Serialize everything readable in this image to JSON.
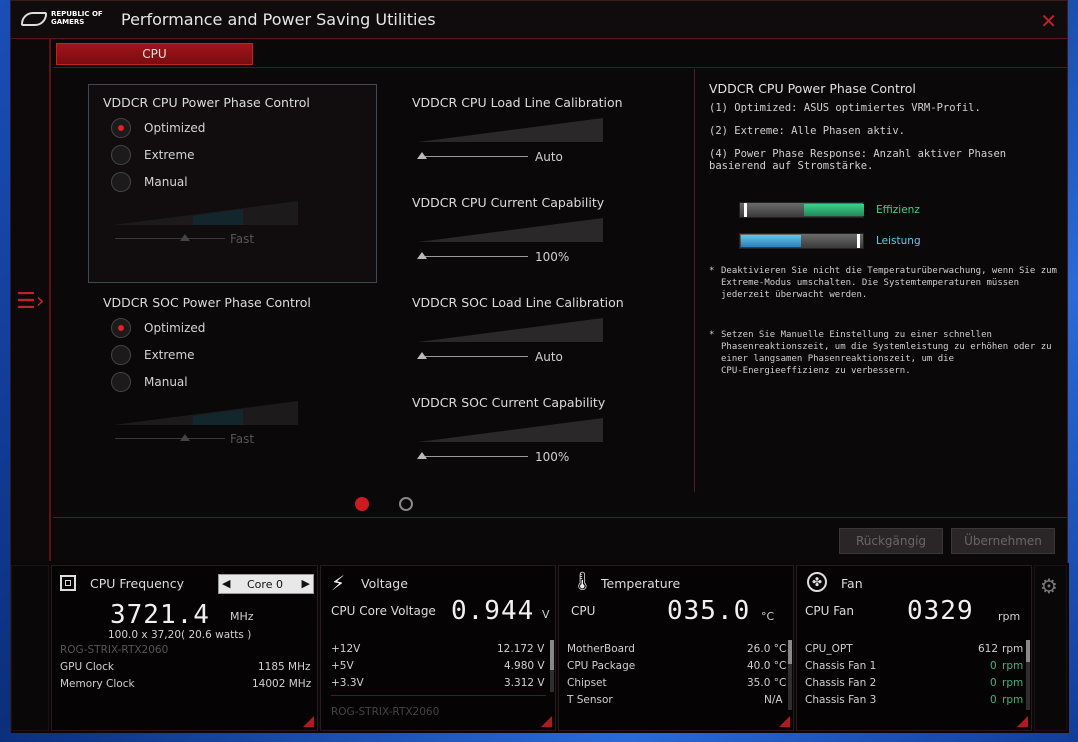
{
  "window": {
    "title": "Performance and Power Saving Utilities",
    "logo_line1": "REPUBLIC OF",
    "logo_line2": "GAMERS"
  },
  "tabs": [
    {
      "label": "CPU"
    }
  ],
  "left": {
    "cpu_phase": {
      "title": "VDDCR CPU Power Phase Control",
      "options": [
        "Optimized",
        "Extreme",
        "Manual"
      ],
      "selected": "Optimized",
      "slider_value": "Fast"
    },
    "soc_phase": {
      "title": "VDDCR SOC Power Phase Control",
      "options": [
        "Optimized",
        "Extreme",
        "Manual"
      ],
      "selected": "Optimized",
      "slider_value": "Fast"
    }
  },
  "middle": {
    "cpu_llc": {
      "title": "VDDCR CPU Load Line Calibration",
      "value": "Auto"
    },
    "cpu_current": {
      "title": "VDDCR CPU Current Capability",
      "value": "100%"
    },
    "soc_llc": {
      "title": "VDDCR SOC Load Line Calibration",
      "value": "Auto"
    },
    "soc_current": {
      "title": "VDDCR SOC Current Capability",
      "value": "100%"
    }
  },
  "info": {
    "title": "VDDCR CPU Power Phase Control",
    "line1": "(1) Optimized: ASUS optimiertes VRM-Profil.",
    "line2": "(2) Extreme: Alle Phasen aktiv.",
    "line3a": "(4) Power Phase Response: Anzahl aktiver Phasen",
    "line3b": "basierend auf Stromstärke.",
    "legend_eff": "Effizienz",
    "legend_perf": "Leistung",
    "note1a": "Deaktivieren Sie nicht die Temperaturüberwachung, wenn Sie zum",
    "note1b": "Extreme-Modus umschalten. Die Systemtemperaturen müssen",
    "note1c": "jederzeit überwacht werden.",
    "note2a": "Setzen Sie Manuelle Einstellung zu einer schnellen",
    "note2b": "Phasenreaktionszeit, um die Systemleistung zu erhöhen oder zu",
    "note2c": "einer langsamen Phasenreaktionszeit, um die",
    "note2d": "CPU-Energieeffizienz zu verbessern.",
    "star": "*"
  },
  "actions": {
    "undo": "Rückgängig",
    "apply": "Übernehmen"
  },
  "cpu_panel": {
    "title": "CPU Frequency",
    "core": "Core 0",
    "freq": "3721.4",
    "freq_unit": "MHz",
    "formula": "100.0  x 37,20( 20.6   watts )",
    "gpu_name": "ROG-STRIX-RTX2060",
    "gpu_clock_label": "GPU Clock",
    "gpu_clock": "1185 MHz",
    "mem_clock_label": "Memory Clock",
    "mem_clock": "14002 MHz"
  },
  "voltage_panel": {
    "title": "Voltage",
    "main_label": "CPU Core Voltage",
    "main_value": "0.944",
    "main_unit": "V",
    "rows": [
      [
        "+12V",
        "12.172 V"
      ],
      [
        "+5V",
        "4.980 V"
      ],
      [
        "+3.3V",
        "3.312 V"
      ]
    ],
    "footer": "ROG-STRIX-RTX2060"
  },
  "temp_panel": {
    "title": "Temperature",
    "main_label": "CPU",
    "main_value": "035.0",
    "main_unit": "°C",
    "rows": [
      [
        "MotherBoard",
        "26.0 °C"
      ],
      [
        "CPU Package",
        "40.0 °C"
      ],
      [
        "Chipset",
        "35.0 °C"
      ],
      [
        "T Sensor",
        "N/A"
      ]
    ]
  },
  "fan_panel": {
    "title": "Fan",
    "main_label": "CPU Fan",
    "main_value": "0329",
    "main_unit": "rpm",
    "rows": [
      [
        "CPU_OPT",
        "612",
        "rpm"
      ],
      [
        "Chassis Fan 1",
        "0",
        "rpm"
      ],
      [
        "Chassis Fan 2",
        "0",
        "rpm"
      ],
      [
        "Chassis Fan 3",
        "0",
        "rpm"
      ]
    ]
  },
  "colors": {
    "accent": "#c0222a",
    "bg": "#0a0708"
  }
}
